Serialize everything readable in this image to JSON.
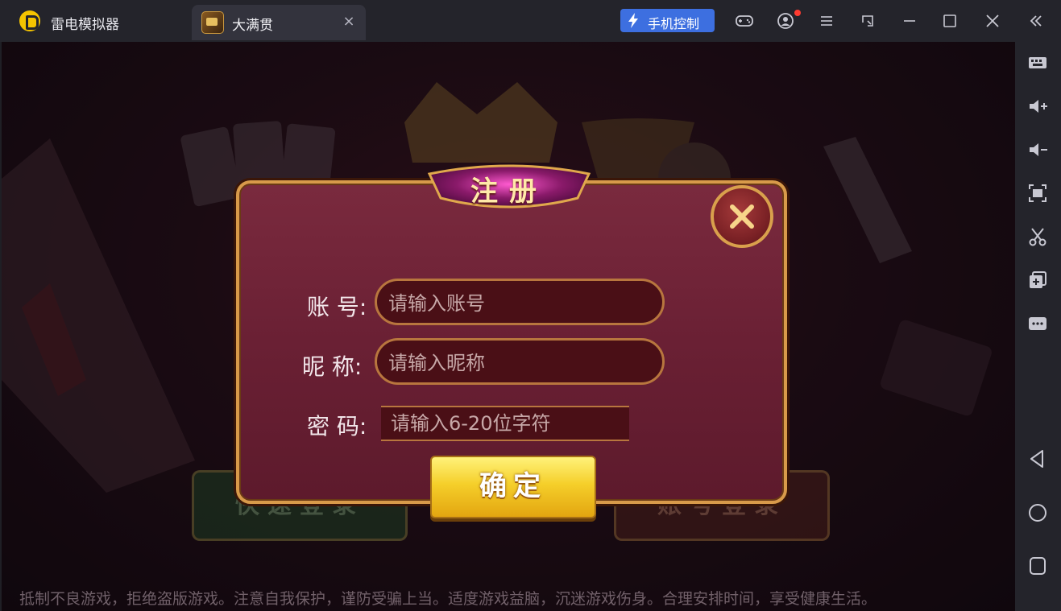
{
  "window": {
    "app_title": "雷电模拟器",
    "tab_label": "大满贯",
    "phone_control_label": "手机控制",
    "tab_close_glyph": "×"
  },
  "toolbar_icons": [
    "gamepad-icon",
    "account-icon",
    "menu-icon",
    "restore-window-icon",
    "minimize-icon",
    "maximize-icon",
    "close-window-icon",
    "collapse-sidebar-icon"
  ],
  "sidebar_icons": [
    "keyboard-icon",
    "volume-up-icon",
    "volume-down-icon",
    "screenshot-icon",
    "scissors-icon",
    "add-window-icon",
    "more-icon",
    "back-icon",
    "home-icon",
    "recents-icon"
  ],
  "game": {
    "background_buttons": {
      "quick_login": "快速登录",
      "account_login": "账号登录"
    },
    "notice": "抵制不良游戏，拒绝盗版游戏。注意自我保护，谨防受骗上当。适度游戏益脑，沉迷游戏伤身。合理安排时间，享受健康生活。"
  },
  "register_dialog": {
    "title": "注册",
    "account_label": "账 号:",
    "account_placeholder": "请输入账号",
    "nickname_label": "昵 称:",
    "nickname_placeholder": "请输入昵称",
    "password_label": "密 码:",
    "password_placeholder": "请输入6-20位字符",
    "confirm_label": "确定"
  },
  "colors": {
    "accent_blue": "#3d6fe0",
    "dialog_bg": "#6a2034",
    "gold_border": "#d89a4a",
    "confirm_gold": "#f5cf2a"
  }
}
